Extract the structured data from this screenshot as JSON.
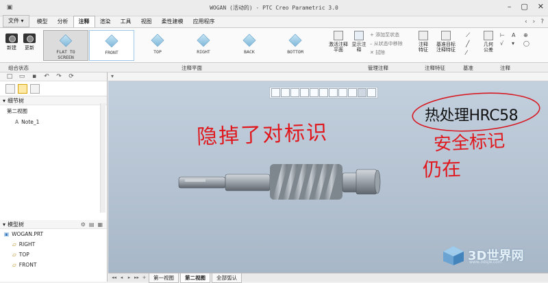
{
  "window": {
    "title": "WOGAN (活动的) - PTC Creo Parametric 3.0"
  },
  "menubar": {
    "file": "文件",
    "tabs": [
      "模型",
      "分析",
      "注释",
      "渲染",
      "工具",
      "视图",
      "柔性建模",
      "应用程序"
    ],
    "active_tab": "注释"
  },
  "ribbon": {
    "new_label": "新建",
    "update_label": "更新",
    "views": [
      {
        "label": "FLAT TO SCREEN",
        "line1": "FLAT TO",
        "line2": "SCREEN"
      },
      {
        "label": "FRONT"
      },
      {
        "label": "TOP"
      },
      {
        "label": "RIGHT"
      },
      {
        "label": "BACK"
      },
      {
        "label": "BOTTOM"
      }
    ],
    "activate_annotation": "激活注释平面",
    "show_annotation": "显示注释",
    "add_to_state": "添加至状态",
    "remove_from_state": "从状态中移除",
    "erase": "拭除",
    "annotation_feature": "注释特征",
    "datum_feature": "基准目标注释特征",
    "geom_tolerance": "几何公差",
    "groups": {
      "combined_state": "组合状态",
      "annotation_plane": "注释平面",
      "manage_annotation": "管理注释",
      "annotation_feature": "注释特征",
      "datum": "基准",
      "annotation": "注释"
    }
  },
  "sidebar": {
    "detail_tree": "细节树",
    "second_view": "第二视图",
    "note": "Note_1",
    "model_tree": "模型树",
    "model_items": [
      "WOGAN.PRT",
      "RIGHT",
      "TOP",
      "FRONT"
    ]
  },
  "canvas": {
    "annotation_text": "热处理HRC58",
    "handwriting_1": "隐掉了对标识",
    "handwriting_2": "安全标记",
    "handwriting_3": "仍在"
  },
  "bottom_tabs": [
    "第一视图",
    "第二视图",
    "全部弧认"
  ],
  "bottom_active": "第二视图",
  "watermark": {
    "main": "3D世界网",
    "sub": "www.3dsjw.com"
  },
  "colors": {
    "viewport_top": "#c4d1df",
    "viewport_bottom": "#a8b7c7",
    "ink_red": "#e0181e",
    "circle_red": "#d71a22"
  }
}
